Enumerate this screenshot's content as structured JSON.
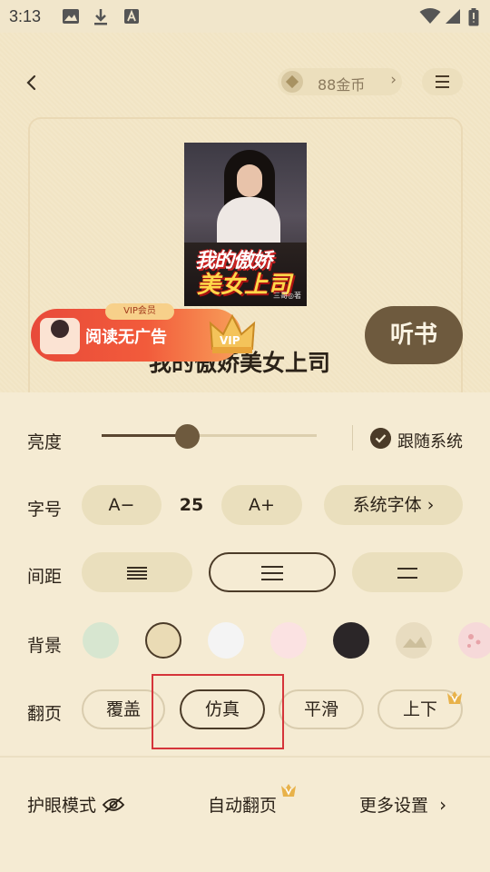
{
  "status_bar": {
    "time": "3:13"
  },
  "header": {
    "coins_label": "88金币"
  },
  "book": {
    "cover_title_line1": "我的傲娇",
    "cover_title_line2": "美女上司",
    "cover_author": "三哥◎著",
    "title": "我的傲娇美女上司"
  },
  "vip_banner": {
    "tag": "VIP会员",
    "text": "阅读无广告",
    "crown_text": "VIP"
  },
  "listen_button": "听书",
  "settings": {
    "brightness": {
      "label": "亮度",
      "value": 0.4,
      "follow_system_label": "跟随系统",
      "follow_system_checked": true
    },
    "font_size": {
      "label": "字号",
      "decrease_label": "A−",
      "value": "25",
      "increase_label": "A+",
      "font_family_label": "系统字体 ›"
    },
    "spacing": {
      "label": "间距",
      "options": [
        "compact",
        "normal",
        "loose"
      ],
      "selected_index": 1
    },
    "background": {
      "label": "背景",
      "colors": [
        "#d7e6d0",
        "#eadbb5",
        "#f4f4f4",
        "#fbe2e2",
        "#2b2628",
        "#e8dcc0",
        "#f6d9d9"
      ],
      "selected_index": 1
    },
    "page_turn": {
      "label": "翻页",
      "options": [
        "覆盖",
        "仿真",
        "平滑",
        "上下"
      ],
      "selected_index": 1
    }
  },
  "bottom_bar": {
    "eye_mode": "护眼模式",
    "auto_page": "自动翻页",
    "more_settings": "更多设置"
  },
  "colors": {
    "accent": "#6e5a3e",
    "highlight": "#d5343a",
    "vip_gold": "#e8b24a"
  }
}
